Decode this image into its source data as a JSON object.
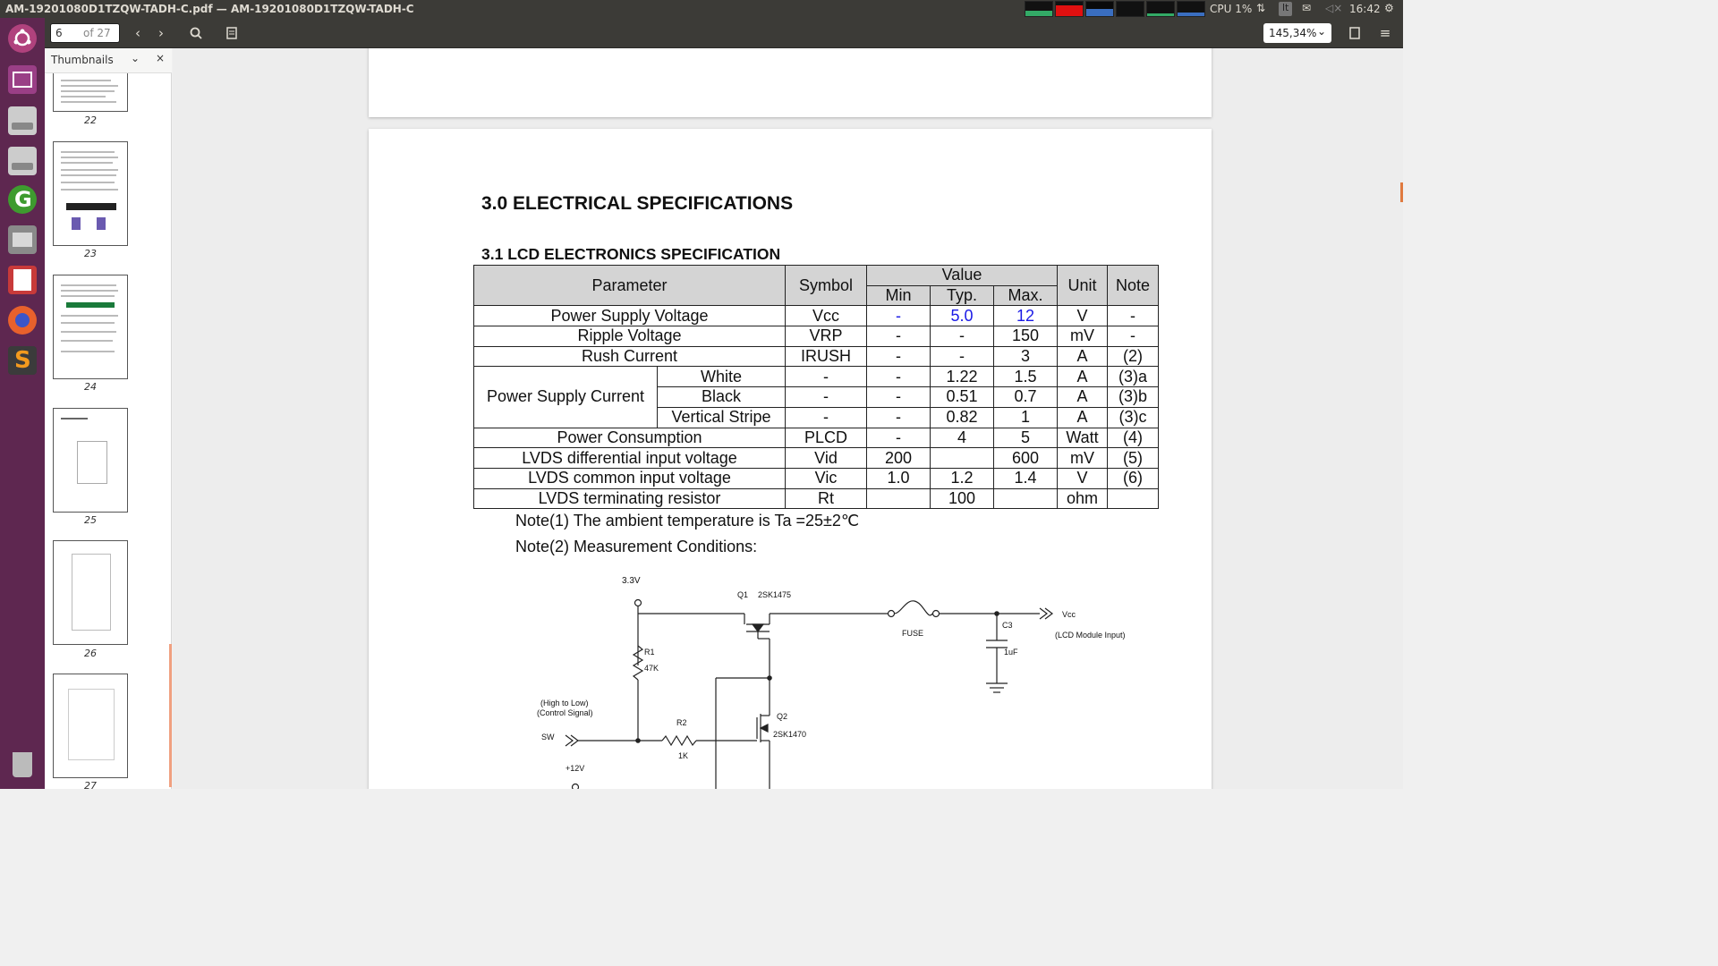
{
  "window": {
    "title": "AM-19201080D1TZQW-TADH-C.pdf — AM-19201080D1TZQW-TADH-C"
  },
  "system": {
    "cpu_label": "CPU 1%",
    "keyboard_layout": "lt",
    "clock": "16:42"
  },
  "launcher": {
    "items": [
      "ubuntu-dash",
      "workspace-switcher",
      "disk-drive",
      "disk-drive-2",
      "update-manager",
      "file-manager",
      "document-viewer",
      "firefox",
      "sublime-text",
      "trash"
    ]
  },
  "toolbar": {
    "page_current": "6",
    "page_total": "of 27",
    "zoom": "145,34%"
  },
  "sidebar": {
    "title": "Thumbnails",
    "thumbnails": [
      "22",
      "23",
      "24",
      "25",
      "26",
      "27"
    ]
  },
  "document": {
    "heading": "3.0 ELECTRICAL SPECIFICATIONS",
    "subheading": "3.1 LCD ELECTRONICS SPECIFICATION",
    "table": {
      "headers": {
        "parameter": "Parameter",
        "symbol": "Symbol",
        "value": "Value",
        "min": "Min",
        "typ": "Typ.",
        "max": "Max.",
        "unit": "Unit",
        "note": "Note"
      },
      "rows": [
        {
          "parameter": "Power Supply Voltage",
          "symbol": "Vcc",
          "min": "-",
          "typ": "5.0",
          "max": "12",
          "unit": "V",
          "note": "-"
        },
        {
          "parameter": "Ripple Voltage",
          "symbol": "VRP",
          "min": "-",
          "typ": "-",
          "max": "150",
          "unit": "mV",
          "note": "-"
        },
        {
          "parameter": "Rush Current",
          "symbol": "IRUSH",
          "min": "-",
          "typ": "-",
          "max": "3",
          "unit": "A",
          "note": "(2)"
        },
        {
          "parameter": "Power Supply Current",
          "sub": "White",
          "symbol": "-",
          "min": "-",
          "typ": "1.22",
          "max": "1.5",
          "unit": "A",
          "note": "(3)a"
        },
        {
          "sub": "Black",
          "symbol": "-",
          "min": "-",
          "typ": "0.51",
          "max": "0.7",
          "unit": "A",
          "note": "(3)b"
        },
        {
          "sub": "Vertical Stripe",
          "symbol": "-",
          "min": "-",
          "typ": "0.82",
          "max": "1",
          "unit": "A",
          "note": "(3)c"
        },
        {
          "parameter": "Power Consumption",
          "symbol": "PLCD",
          "min": "-",
          "typ": "4",
          "max": "5",
          "unit": "Watt",
          "note": "(4)"
        },
        {
          "parameter": "LVDS differential input voltage",
          "symbol": "Vid",
          "min": "200",
          "typ": "",
          "max": "600",
          "unit": "mV",
          "note": "(5)"
        },
        {
          "parameter": "LVDS common input voltage",
          "symbol": "Vic",
          "min": "1.0",
          "typ": "1.2",
          "max": "1.4",
          "unit": "V",
          "note": "(6)"
        },
        {
          "parameter": "LVDS terminating resistor",
          "symbol": "Rt",
          "min": "",
          "typ": "100",
          "max": "",
          "unit": "ohm",
          "note": ""
        }
      ]
    },
    "note1": "Note(1) The ambient temperature is Ta =25±2℃",
    "note2": "Note(2) Measurement Conditions:",
    "circuit": {
      "v33": "3.3V",
      "q1": "Q1",
      "q1_part": "2SK1475",
      "fuse": "FUSE",
      "c3": "C3",
      "c3_val": "1uF",
      "vcc": "Vcc",
      "vcc_desc": "(LCD Module Input)",
      "r1": "R1",
      "r1_val": "47K",
      "r2": "R2",
      "r2_val": "1K",
      "q2": "Q2",
      "q2_part": "2SK1470",
      "ctrl1": "(High to Low)",
      "ctrl2": "(Control Signal)",
      "sw": "SW",
      "v12": "+12V"
    }
  }
}
